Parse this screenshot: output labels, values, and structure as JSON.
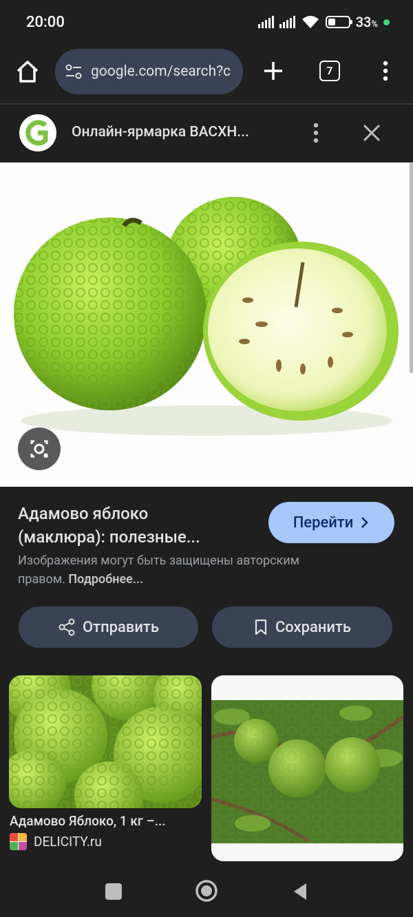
{
  "status_bar": {
    "time": "20:00",
    "battery_percent": "33",
    "battery_suffix": "%",
    "battery_level": 0.33
  },
  "toolbar": {
    "url": "google.com/search?c",
    "tab_count": "7"
  },
  "site": {
    "title": "Онлайн-ярмарка ВАСХН..."
  },
  "result": {
    "title_line1": "Адамово яблоко",
    "title_line2": "(маклюра): полезные...",
    "visit_label": "Перейти",
    "copyright_text": "Изображения могут быть защищены авторским правом.",
    "more_link": "Подробнее...",
    "share_label": "Отправить",
    "save_label": "Сохранить"
  },
  "related": [
    {
      "title": "Адамово Яблоко, 1 кг –...",
      "source": "DELICITY.ru"
    },
    {
      "title": "",
      "source": ""
    }
  ],
  "colors": {
    "background": "#1f1f1f",
    "accent_button": "#a8c7fa",
    "secondary_button": "#3a4254",
    "omnibox": "#3c4255"
  }
}
